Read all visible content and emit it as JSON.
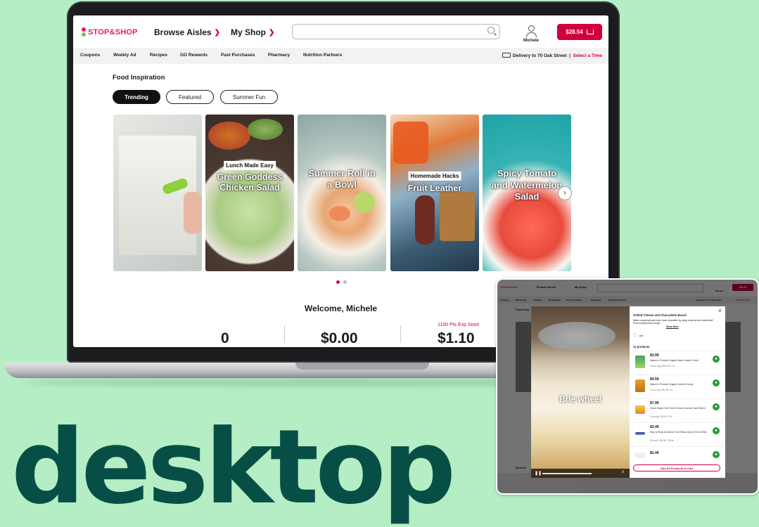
{
  "brand": {
    "name": "STOP&SHOP",
    "colors": {
      "accent": "#d1003d",
      "background": "#b5eec4",
      "headline": "#074f46",
      "plus": "#1d9b3a"
    }
  },
  "header": {
    "browse_aisles": "Browse Aisles",
    "my_shop": "My Shop",
    "search_placeholder": "",
    "user_name": "Michele",
    "cart_total": "$28.54"
  },
  "subnav": {
    "items": [
      "Coupons",
      "Weekly Ad",
      "Recipes",
      "GO Rewards",
      "Past Purchases",
      "Pharmacy",
      "Nutrition Partners"
    ],
    "delivery_label": "Delivery",
    "delivery_to": "to 70 Oak Street",
    "select_time": "Select a Time"
  },
  "food_inspiration": {
    "title": "Food Inspiration",
    "tabs": [
      "Trending",
      "Featured",
      "Summer Fun"
    ],
    "active_tab": "Trending",
    "cards": [
      {
        "tag": "",
        "title": ""
      },
      {
        "tag": "Lunch Made Easy",
        "title": "Green Goddess Chicken Salad"
      },
      {
        "tag": "",
        "title": "Summer Roll in a Bowl"
      },
      {
        "tag": "Homemade Hacks",
        "title": "Fruit Leather"
      },
      {
        "tag": "",
        "title": "Spicy Tomato and Watermelon Salad"
      }
    ],
    "carousel_page": 1,
    "carousel_pages": 2
  },
  "welcome": {
    "greeting": "Welcome, Michele",
    "stats": [
      "0",
      "$0.00",
      "$1.10"
    ],
    "points_note": "1100 Pts Exp Soon"
  },
  "inset": {
    "browse_aisles": "Browse Aisles",
    "my_shop": "My Shop",
    "user_name": "Michele",
    "cart_total": "$28.54",
    "subnav_items": [
      "Coupons",
      "Weekly Ad",
      "Recipes",
      "GO Rewards",
      "Past Purchases",
      "Pharmacy",
      "Nutrition Partners"
    ],
    "delivery": "Delivery to 70 Oak Street",
    "select_time": "Select a Time",
    "food_inspiration": "Food Insp",
    "best_deals": "Best De",
    "video_caption": "Brie wheel",
    "modal": {
      "title": "Grilled Cheese and Charcuterie Board",
      "description": "Make a grazing board even more shareable by using bread as the board itself. Some bought pizza dough...",
      "show_more": "Show More",
      "like": "Like",
      "products_count": "11 products",
      "products": [
        {
          "price": "$3.99",
          "name": "Nature's Promise Organic Basil Leaves Fresh",
          "size": "0.5 oz pkg | $31.92 / oz"
        },
        {
          "price": "$4.59",
          "name": "Nature's Promise Organic Golden Honey",
          "size": "12 oz squ | $0.38 / oz"
        },
        {
          "price": "$7.99",
          "name": "Oscar Mayer Deli Fresh Honey Uncured Ham Sliced",
          "size": "9 oz pkg | $14.21 / lb"
        },
        {
          "price": "$3.49",
          "name": "Stop & Shop Aluminum Foil Heavy Duty 12 Inch Wide",
          "size": "50 sq ft | $6.98 / 100sf"
        },
        {
          "price": "$2.49",
          "name": "",
          "size": ""
        }
      ],
      "add_all": "Add All Products to Cart"
    }
  },
  "headline": "desktop"
}
